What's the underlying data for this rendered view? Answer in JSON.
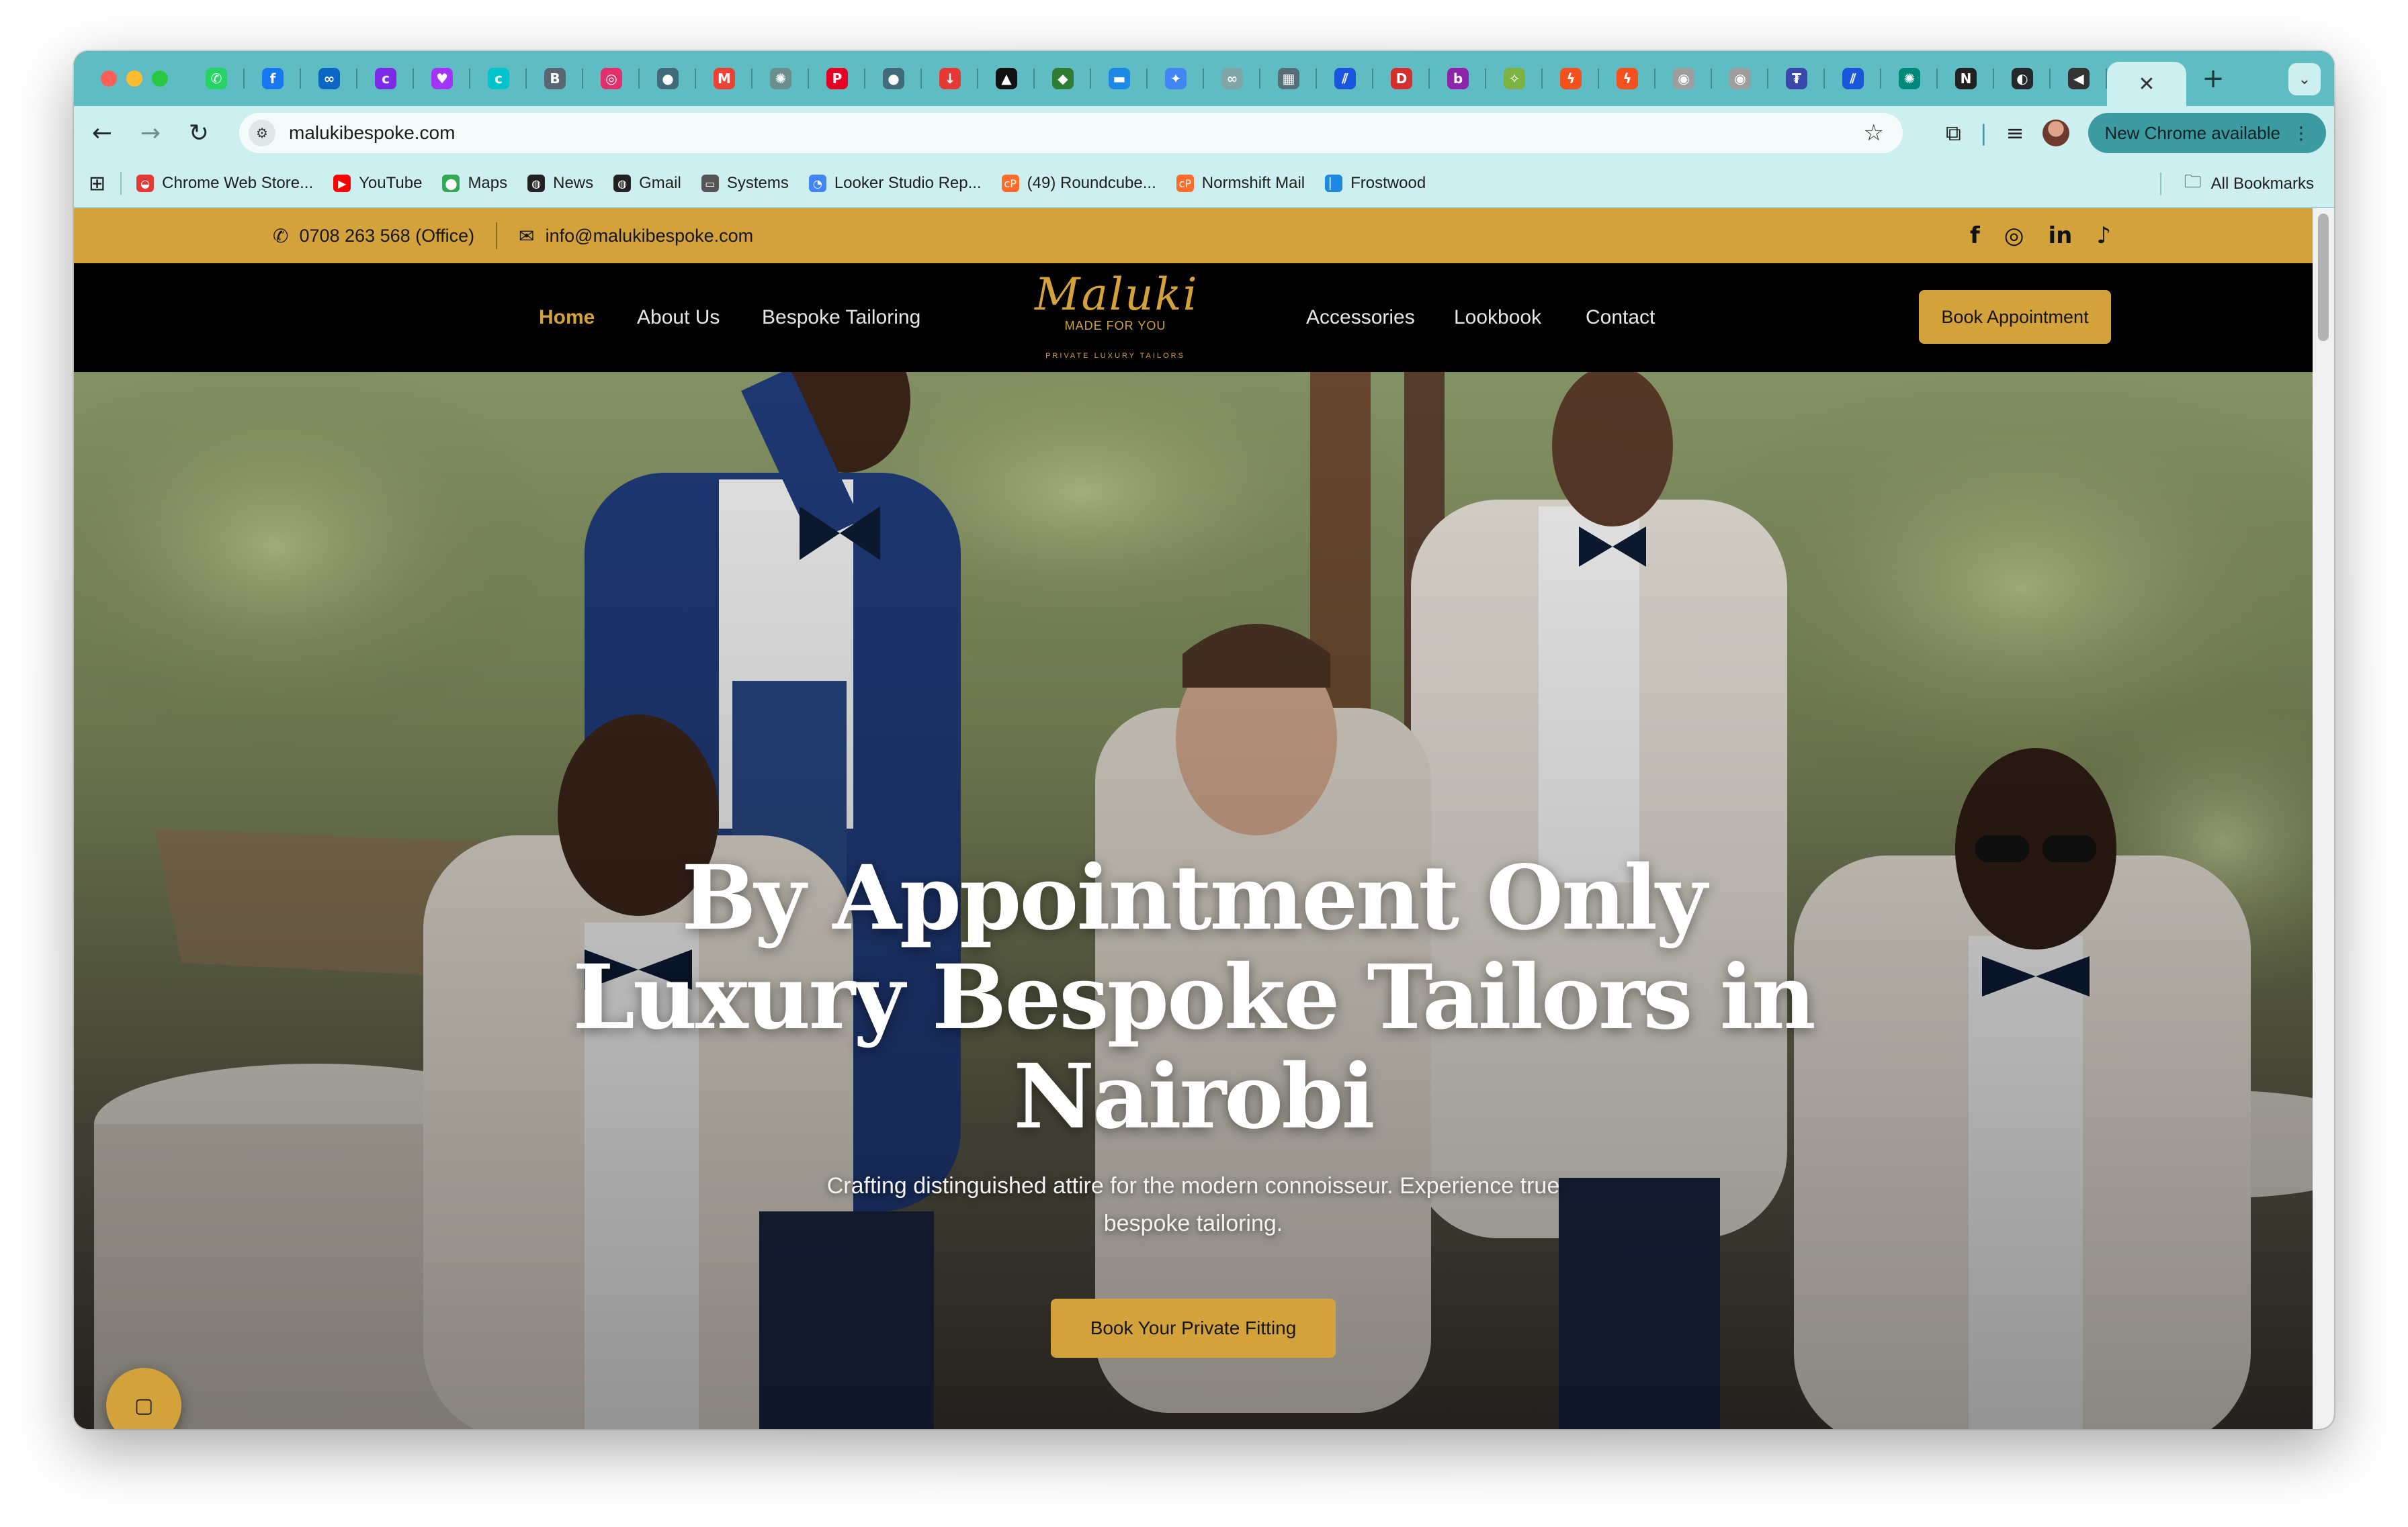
{
  "browser": {
    "tabs": [
      {
        "icon": "whatsapp-icon",
        "color": "#25d366",
        "glyph": "✆"
      },
      {
        "icon": "facebook-icon",
        "color": "#1877f2",
        "glyph": "f"
      },
      {
        "icon": "meta-icon",
        "color": "#0a66c2",
        "glyph": "∞"
      },
      {
        "icon": "canva-icon",
        "color": "#7d2ae8",
        "glyph": "c"
      },
      {
        "icon": "messenger-icon",
        "color": "#a334fa",
        "glyph": "♥"
      },
      {
        "icon": "canva-icon",
        "color": "#00c4cc",
        "glyph": "c"
      },
      {
        "icon": "page-icon",
        "color": "#596773",
        "glyph": "B"
      },
      {
        "icon": "instagram-icon",
        "color": "#e1306c",
        "glyph": "◎"
      },
      {
        "icon": "chat-icon",
        "color": "#3f6b7a",
        "glyph": "●"
      },
      {
        "icon": "gmail-icon",
        "color": "#ea4335",
        "glyph": "M"
      },
      {
        "icon": "openai-icon",
        "color": "#6b8f8f",
        "glyph": "✺"
      },
      {
        "icon": "pinterest-icon",
        "color": "#e60023",
        "glyph": "P"
      },
      {
        "icon": "chat-icon",
        "color": "#3f6b7a",
        "glyph": "●"
      },
      {
        "icon": "download-icon",
        "color": "#e53935",
        "glyph": "↓"
      },
      {
        "icon": "triangle-icon",
        "color": "#111111",
        "glyph": "▲"
      },
      {
        "icon": "leaf-icon",
        "color": "#2e7d32",
        "glyph": "◆"
      },
      {
        "icon": "flag-icon",
        "color": "#1e88e5",
        "glyph": "▬"
      },
      {
        "icon": "gemini-icon",
        "color": "#4285f4",
        "glyph": "✦"
      },
      {
        "icon": "link-icon",
        "color": "#7fa5a8",
        "glyph": "∞"
      },
      {
        "icon": "chart-icon",
        "color": "#546e7a",
        "glyph": "▦"
      },
      {
        "icon": "stripe-icon",
        "color": "#1a56db",
        "glyph": "⫽"
      },
      {
        "icon": "doc-icon",
        "color": "#d32f2f",
        "glyph": "D"
      },
      {
        "icon": "app-icon",
        "color": "#8e24aa",
        "glyph": "b"
      },
      {
        "icon": "puzzle-icon",
        "color": "#7cb342",
        "glyph": "✧"
      },
      {
        "icon": "bolt-icon",
        "color": "#f4511e",
        "glyph": "ϟ"
      },
      {
        "icon": "bolt-icon",
        "color": "#f4511e",
        "glyph": "ϟ"
      },
      {
        "icon": "circle-icon",
        "color": "#9e9e9e",
        "glyph": "◉"
      },
      {
        "icon": "circle-icon",
        "color": "#9e9e9e",
        "glyph": "◉"
      },
      {
        "icon": "tether-icon",
        "color": "#3949ab",
        "glyph": "₮"
      },
      {
        "icon": "stripe-icon",
        "color": "#1a56db",
        "glyph": "⫽"
      },
      {
        "icon": "globe-icon",
        "color": "#00897b",
        "glyph": "✺"
      },
      {
        "icon": "notion-icon",
        "color": "#222222",
        "glyph": "N"
      },
      {
        "icon": "github-icon",
        "color": "#24292e",
        "glyph": "◐"
      },
      {
        "icon": "audio-icon",
        "color": "#333333",
        "glyph": "◀"
      }
    ],
    "active_tab_close": "✕",
    "new_tab": "+",
    "tab_menu": "⌄",
    "url": "malukibespoke.com",
    "update_label": "New Chrome available",
    "bookmarks": [
      {
        "label": "Chrome Web Store...",
        "icon": "chrome-store-icon",
        "color": "#e53935",
        "glyph": "◒"
      },
      {
        "label": "YouTube",
        "icon": "youtube-icon",
        "color": "#ff0000",
        "glyph": "▶"
      },
      {
        "label": "Maps",
        "icon": "maps-icon",
        "color": "#34a853",
        "glyph": "⬤"
      },
      {
        "label": "News",
        "icon": "globe-icon",
        "color": "#222222",
        "glyph": "◍"
      },
      {
        "label": "Gmail",
        "icon": "globe-icon",
        "color": "#222222",
        "glyph": "◍"
      },
      {
        "label": "Systems",
        "icon": "folder-icon",
        "color": "#555555",
        "glyph": "▭"
      },
      {
        "label": "Looker Studio Rep...",
        "icon": "looker-icon",
        "color": "#4285f4",
        "glyph": "◔"
      },
      {
        "label": "(49) Roundcube...",
        "icon": "cpanel-icon",
        "color": "#ff6c2c",
        "glyph": "cP"
      },
      {
        "label": "Normshift Mail",
        "icon": "cpanel-icon",
        "color": "#ff6c2c",
        "glyph": "cP"
      },
      {
        "label": "Frostwood",
        "icon": "frostwood-icon",
        "color": "#1e88e5",
        "glyph": "▏"
      }
    ],
    "all_bookmarks": "All Bookmarks"
  },
  "site": {
    "topbar": {
      "phone": "0708 263 568 (Office)",
      "email": "info@malukibespoke.com",
      "socials": [
        {
          "icon": "facebook-icon",
          "glyph": "f"
        },
        {
          "icon": "instagram-icon",
          "glyph": "◎"
        },
        {
          "icon": "linkedin-icon",
          "glyph": "in"
        },
        {
          "icon": "tiktok-icon",
          "glyph": "♪"
        }
      ]
    },
    "nav": {
      "home": "Home",
      "about": "About Us",
      "tailoring": "Bespoke Tailoring",
      "accessories": "Accessories",
      "lookbook": "Lookbook",
      "contact": "Contact",
      "book": "Book Appointment"
    },
    "logo": {
      "brand": "Maluki",
      "tagline": "MADE FOR YOU",
      "subtagline": "PRIVATE LUXURY TAILORS"
    },
    "hero": {
      "title_line1": "By Appointment Only",
      "title_line2": "Luxury Bespoke Tailors in",
      "title_line3": "Nairobi",
      "subtitle": "Crafting distinguished attire for the modern connoisseur. Experience true bespoke tailoring.",
      "cta": "Book Your Private Fitting"
    }
  },
  "colors": {
    "accent_gold": "#d4a23a",
    "chrome_teal": "#5fbcc2",
    "chrome_light": "#cdeff0"
  }
}
